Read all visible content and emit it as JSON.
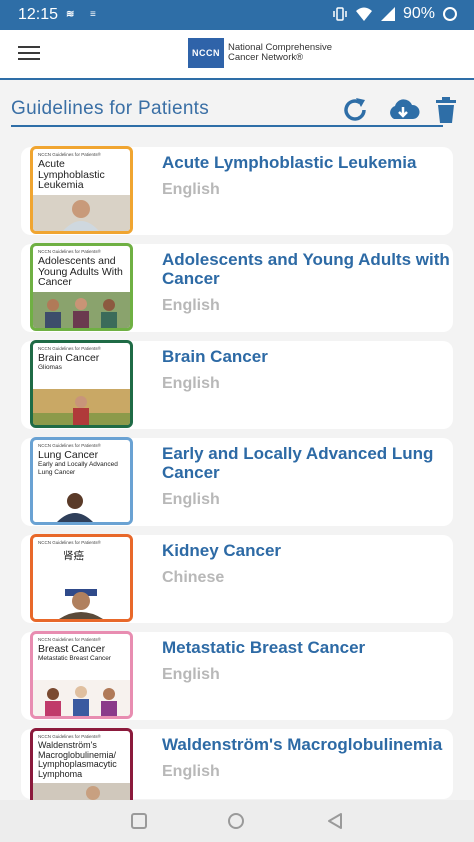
{
  "status": {
    "time": "12:15",
    "battery": "90%",
    "mini_icons": [
      "≋",
      "≡"
    ]
  },
  "app_bar": {
    "logo_abbr": "NCCN",
    "logo_text": "National Comprehensive Cancer Network®"
  },
  "section": {
    "title": "Guidelines for Patients"
  },
  "cover_series": "NCCN Guidelines for Patients®",
  "items": [
    {
      "title": "Acute Lymphoblastic Leukemia",
      "language": "English",
      "cover_title": "Acute Lymphoblastic Leukemia",
      "cover_sub": "",
      "cover_color": "#f0a531"
    },
    {
      "title": "Adolescents and Young Adults with Cancer",
      "language": "English",
      "cover_title": "Adolescents and Young Adults With Cancer",
      "cover_sub": "",
      "cover_color": "#6fb043"
    },
    {
      "title": "Brain Cancer",
      "language": "English",
      "cover_title": "Brain Cancer",
      "cover_sub": "Gliomas",
      "cover_color": "#1f6b46"
    },
    {
      "title": "Early and Locally Advanced Lung Cancer",
      "language": "English",
      "cover_title": "Lung Cancer",
      "cover_sub": "Early and Locally Advanced Lung Cancer",
      "cover_color": "#6aa2d3"
    },
    {
      "title": "Kidney Cancer",
      "language": "Chinese",
      "cover_title": "肾癌",
      "cover_sub": "",
      "cover_color": "#e8682a"
    },
    {
      "title": "Metastatic Breast Cancer",
      "language": "English",
      "cover_title": "Breast Cancer",
      "cover_sub": "Metastatic Breast Cancer",
      "cover_color": "#e88db1"
    },
    {
      "title": "Waldenström's Macroglobulinemia",
      "language": "English",
      "cover_title": "Waldenström's Macroglobulinemia/ Lymphoplasmacytic Lymphoma",
      "cover_sub": "",
      "cover_color": "#8b1a3c"
    }
  ]
}
